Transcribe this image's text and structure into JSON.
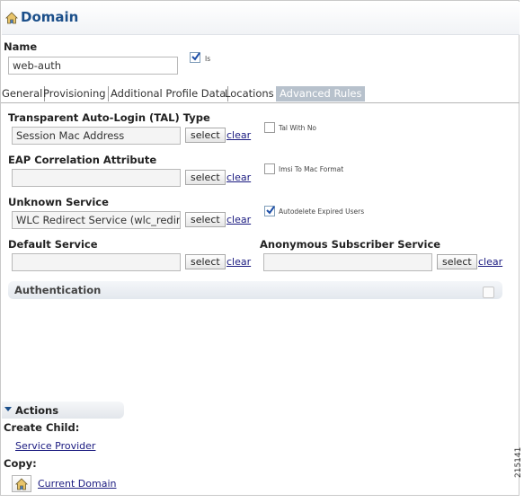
{
  "header": {
    "title": "Domain",
    "icon": "home-icon"
  },
  "name_field": {
    "label": "Name",
    "value": "web-auth"
  },
  "is_checkbox": {
    "label": "Is",
    "checked": true
  },
  "tabs": [
    {
      "label": "General"
    },
    {
      "label": "Provisioning"
    },
    {
      "label": "Additional Profile Data"
    },
    {
      "label": "Locations"
    },
    {
      "label": "Advanced Rules",
      "active": true
    }
  ],
  "tal": {
    "label": "Transparent Auto-Login (TAL) Type",
    "value": "Session Mac Address",
    "select": "select",
    "clear": "clear"
  },
  "eap": {
    "label": "EAP Correlation Attribute",
    "value": "",
    "select": "select",
    "clear": "clear"
  },
  "unknown_service": {
    "label": "Unknown Service",
    "value": "WLC Redirect Service (wlc_redirect",
    "select": "select",
    "clear": "clear"
  },
  "default_service": {
    "label": "Default Service",
    "value": "",
    "select": "select",
    "clear": "clear"
  },
  "anon_service": {
    "label": "Anonymous Subscriber Service",
    "value": "",
    "select": "select",
    "clear": "clear"
  },
  "options": {
    "tal_with_no": {
      "label": "Tal With No",
      "checked": false
    },
    "imsi_to_mac": {
      "label": "Imsi To Mac Format",
      "checked": false
    },
    "autodelete": {
      "label": "Autodelete Expired Users",
      "checked": true
    }
  },
  "authentication": {
    "label": "Authentication"
  },
  "actions": {
    "title": "Actions",
    "create_child_label": "Create Child:",
    "service_provider_link": "Service Provider",
    "copy_label": "Copy:",
    "current_domain_link": "Current Domain"
  },
  "figure_id": "215141",
  "colors": {
    "title": "#1b4f8a",
    "active_tab": "#b7c1cc",
    "link": "#1a1a80"
  }
}
